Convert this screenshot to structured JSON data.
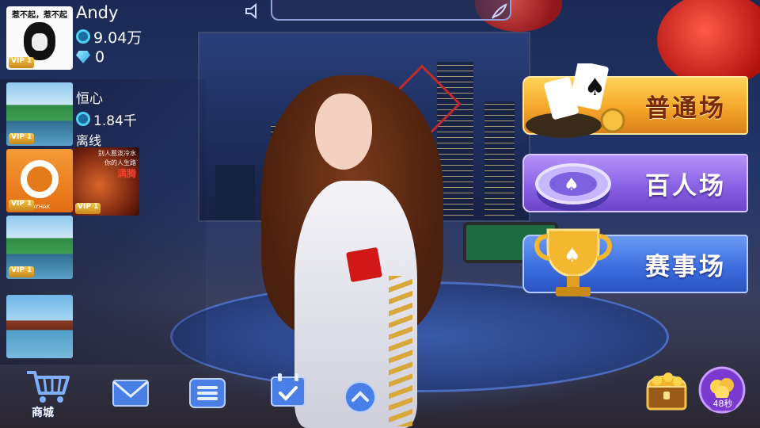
{
  "player": {
    "avatar_caption": "惹不起，惹不起",
    "vip": "VIP 1",
    "name": "Andy",
    "coins": "9.04万",
    "diamonds": "0"
  },
  "friends": {
    "items": [
      {
        "vip": "VIP 1",
        "name": "恒心",
        "coins": "1.84千",
        "status": "离线"
      },
      {
        "vip": "VIP 1",
        "logo_text": "LAYHAK"
      },
      {
        "vip": "VIP 1"
      },
      {
        "vip": ""
      }
    ],
    "fist_card": {
      "vip": "VIP 1",
      "line1": "别人惹泼冷水",
      "line2": "你的人生路",
      "line3": "满腾"
    }
  },
  "modes": [
    {
      "label": "普通场",
      "icon": "cards-icon"
    },
    {
      "label": "百人场",
      "icon": "poker-chip-icon"
    },
    {
      "label": "赛事场",
      "icon": "trophy-icon"
    }
  ],
  "bottom_bar": {
    "shop_label": "商城",
    "timer_label": "48秒"
  },
  "colors": {
    "gold_button": "#f4a72a",
    "purple_button": "#8a62e6",
    "blue_button": "#3d6fe0",
    "coin_cyan": "#4fd0f0"
  }
}
